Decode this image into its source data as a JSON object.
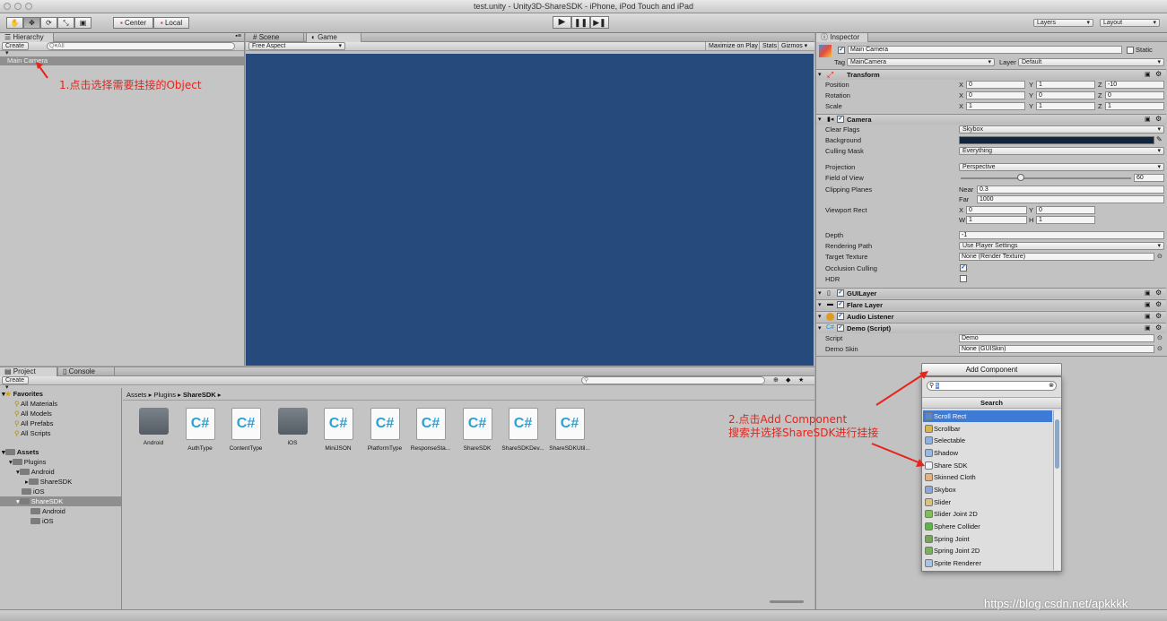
{
  "window": {
    "title": "test.unity - Unity3D-ShareSDK - iPhone, iPod Touch and iPad"
  },
  "toolbar": {
    "tools": [
      "hand-tool",
      "move-tool",
      "rotate-tool",
      "scale-tool",
      "rect-tool"
    ],
    "pivot": "Center",
    "space": "Local",
    "layers": "Layers",
    "layout": "Layout"
  },
  "hierarchy": {
    "tab": "Hierarchy",
    "create": "Create",
    "search_placeholder": "Q▾All",
    "selected": "Main Camera"
  },
  "scene": {
    "tab_scene": "Scene",
    "tab_game": "Game",
    "aspect": "Free Aspect",
    "maximize": "Maximize on Play",
    "stats": "Stats",
    "gizmos": "Gizmos",
    "bg": "#274a7c"
  },
  "annotations": {
    "step1": "1.点击选择需要挂接的Object",
    "step2_line1": "2.点击Add Component",
    "step2_line2": "搜索并选择ShareSDK进行挂接"
  },
  "project": {
    "tab_project": "Project",
    "tab_console": "Console",
    "create": "Create",
    "tree": {
      "favorites": "Favorites",
      "fav_items": [
        "All Materials",
        "All Models",
        "All Prefabs",
        "All Scripts"
      ],
      "assets": "Assets",
      "plugins": "Plugins",
      "android": "Android",
      "sharesdk_sub": "ShareSDK",
      "ios": "iOS",
      "sharesdk": "ShareSDK",
      "sharesdk_android": "Android",
      "sharesdk_ios": "iOS"
    },
    "breadcrumb": [
      "Assets",
      "Plugins",
      "ShareSDK"
    ],
    "assets": [
      {
        "name": "Android",
        "kind": "folder"
      },
      {
        "name": "AuthType",
        "kind": "cs"
      },
      {
        "name": "ContentType",
        "kind": "cs"
      },
      {
        "name": "iOS",
        "kind": "folder"
      },
      {
        "name": "MiniJSON",
        "kind": "cs"
      },
      {
        "name": "PlatformType",
        "kind": "cs"
      },
      {
        "name": "ResponseSta...",
        "kind": "cs"
      },
      {
        "name": "ShareSDK",
        "kind": "cs"
      },
      {
        "name": "ShareSDKDev...",
        "kind": "cs"
      },
      {
        "name": "ShareSDKUtil...",
        "kind": "cs"
      }
    ],
    "cs_glyph": "C#"
  },
  "inspector": {
    "tab": "Inspector",
    "object_name": "Main Camera",
    "static": "Static",
    "tag_label": "Tag",
    "tag_value": "MainCamera",
    "layer_label": "Layer",
    "layer_value": "Default",
    "transform": {
      "title": "Transform",
      "position": {
        "label": "Position",
        "x": "0",
        "y": "1",
        "z": "-10"
      },
      "rotation": {
        "label": "Rotation",
        "x": "0",
        "y": "0",
        "z": "0"
      },
      "scale": {
        "label": "Scale",
        "x": "1",
        "y": "1",
        "z": "1"
      }
    },
    "axis": {
      "x": "X",
      "y": "Y",
      "z": "Z",
      "w": "W",
      "h": "H"
    },
    "camera": {
      "title": "Camera",
      "clear_flags": {
        "label": "Clear Flags",
        "value": "Skybox"
      },
      "background": {
        "label": "Background",
        "color": "#10233f"
      },
      "culling_mask": {
        "label": "Culling Mask",
        "value": "Everything"
      },
      "projection": {
        "label": "Projection",
        "value": "Perspective"
      },
      "fov": {
        "label": "Field of View",
        "value": "60",
        "fraction": 0.33
      },
      "clipping": {
        "label": "Clipping Planes",
        "near_label": "Near",
        "near": "0.3",
        "far_label": "Far",
        "far": "1000"
      },
      "viewport": {
        "label": "Viewport Rect",
        "x": "0",
        "y": "0",
        "w": "1",
        "h": "1"
      },
      "depth": {
        "label": "Depth",
        "value": "-1"
      },
      "rendering_path": {
        "label": "Rendering Path",
        "value": "Use Player Settings"
      },
      "target_texture": {
        "label": "Target Texture",
        "value": "None (Render Texture)"
      },
      "occlusion": {
        "label": "Occlusion Culling"
      },
      "hdr": {
        "label": "HDR"
      }
    },
    "components": [
      "GUILayer",
      "Flare Layer",
      "Audio Listener",
      "Demo (Script)"
    ],
    "demo": {
      "script_label": "Script",
      "script_value": "Demo",
      "skin_label": "Demo Skin",
      "skin_value": "None (GUISkin)"
    },
    "add_component": "Add Component",
    "search_value": "s",
    "search_header": "Search",
    "results": [
      "Scroll Rect",
      "Scrollbar",
      "Selectable",
      "Shadow",
      "Share SDK",
      "Skinned Cloth",
      "Skybox",
      "Slider",
      "Slider Joint 2D",
      "Sphere Collider",
      "Spring Joint",
      "Spring Joint 2D",
      "Sprite Renderer"
    ],
    "result_colors": [
      "#5b86c9",
      "#d9b44a",
      "#8fb1de",
      "#9ab7e0",
      "#eef3fa",
      "#e5b07a",
      "#8aa7d8",
      "#d7c27f",
      "#7fbf5a",
      "#5fb34a",
      "#78a35a",
      "#7ab25a",
      "#a9c2e8"
    ],
    "selected_result": "Scroll Rect"
  },
  "watermark": "https://blog.csdn.net/apkkkk"
}
